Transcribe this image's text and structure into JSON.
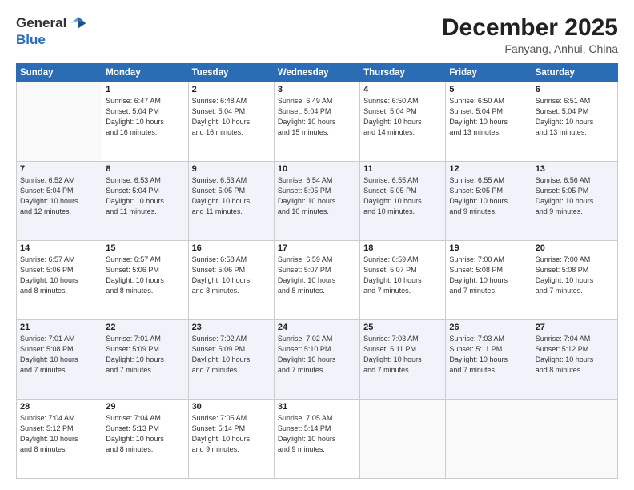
{
  "header": {
    "logo_general": "General",
    "logo_blue": "Blue",
    "month": "December 2025",
    "location": "Fanyang, Anhui, China"
  },
  "days_of_week": [
    "Sunday",
    "Monday",
    "Tuesday",
    "Wednesday",
    "Thursday",
    "Friday",
    "Saturday"
  ],
  "weeks": [
    [
      {
        "day": "",
        "info": ""
      },
      {
        "day": "1",
        "info": "Sunrise: 6:47 AM\nSunset: 5:04 PM\nDaylight: 10 hours\nand 16 minutes."
      },
      {
        "day": "2",
        "info": "Sunrise: 6:48 AM\nSunset: 5:04 PM\nDaylight: 10 hours\nand 16 minutes."
      },
      {
        "day": "3",
        "info": "Sunrise: 6:49 AM\nSunset: 5:04 PM\nDaylight: 10 hours\nand 15 minutes."
      },
      {
        "day": "4",
        "info": "Sunrise: 6:50 AM\nSunset: 5:04 PM\nDaylight: 10 hours\nand 14 minutes."
      },
      {
        "day": "5",
        "info": "Sunrise: 6:50 AM\nSunset: 5:04 PM\nDaylight: 10 hours\nand 13 minutes."
      },
      {
        "day": "6",
        "info": "Sunrise: 6:51 AM\nSunset: 5:04 PM\nDaylight: 10 hours\nand 13 minutes."
      }
    ],
    [
      {
        "day": "7",
        "info": "Sunrise: 6:52 AM\nSunset: 5:04 PM\nDaylight: 10 hours\nand 12 minutes."
      },
      {
        "day": "8",
        "info": "Sunrise: 6:53 AM\nSunset: 5:04 PM\nDaylight: 10 hours\nand 11 minutes."
      },
      {
        "day": "9",
        "info": "Sunrise: 6:53 AM\nSunset: 5:05 PM\nDaylight: 10 hours\nand 11 minutes."
      },
      {
        "day": "10",
        "info": "Sunrise: 6:54 AM\nSunset: 5:05 PM\nDaylight: 10 hours\nand 10 minutes."
      },
      {
        "day": "11",
        "info": "Sunrise: 6:55 AM\nSunset: 5:05 PM\nDaylight: 10 hours\nand 10 minutes."
      },
      {
        "day": "12",
        "info": "Sunrise: 6:55 AM\nSunset: 5:05 PM\nDaylight: 10 hours\nand 9 minutes."
      },
      {
        "day": "13",
        "info": "Sunrise: 6:56 AM\nSunset: 5:05 PM\nDaylight: 10 hours\nand 9 minutes."
      }
    ],
    [
      {
        "day": "14",
        "info": "Sunrise: 6:57 AM\nSunset: 5:06 PM\nDaylight: 10 hours\nand 8 minutes."
      },
      {
        "day": "15",
        "info": "Sunrise: 6:57 AM\nSunset: 5:06 PM\nDaylight: 10 hours\nand 8 minutes."
      },
      {
        "day": "16",
        "info": "Sunrise: 6:58 AM\nSunset: 5:06 PM\nDaylight: 10 hours\nand 8 minutes."
      },
      {
        "day": "17",
        "info": "Sunrise: 6:59 AM\nSunset: 5:07 PM\nDaylight: 10 hours\nand 8 minutes."
      },
      {
        "day": "18",
        "info": "Sunrise: 6:59 AM\nSunset: 5:07 PM\nDaylight: 10 hours\nand 7 minutes."
      },
      {
        "day": "19",
        "info": "Sunrise: 7:00 AM\nSunset: 5:08 PM\nDaylight: 10 hours\nand 7 minutes."
      },
      {
        "day": "20",
        "info": "Sunrise: 7:00 AM\nSunset: 5:08 PM\nDaylight: 10 hours\nand 7 minutes."
      }
    ],
    [
      {
        "day": "21",
        "info": "Sunrise: 7:01 AM\nSunset: 5:08 PM\nDaylight: 10 hours\nand 7 minutes."
      },
      {
        "day": "22",
        "info": "Sunrise: 7:01 AM\nSunset: 5:09 PM\nDaylight: 10 hours\nand 7 minutes."
      },
      {
        "day": "23",
        "info": "Sunrise: 7:02 AM\nSunset: 5:09 PM\nDaylight: 10 hours\nand 7 minutes."
      },
      {
        "day": "24",
        "info": "Sunrise: 7:02 AM\nSunset: 5:10 PM\nDaylight: 10 hours\nand 7 minutes."
      },
      {
        "day": "25",
        "info": "Sunrise: 7:03 AM\nSunset: 5:11 PM\nDaylight: 10 hours\nand 7 minutes."
      },
      {
        "day": "26",
        "info": "Sunrise: 7:03 AM\nSunset: 5:11 PM\nDaylight: 10 hours\nand 7 minutes."
      },
      {
        "day": "27",
        "info": "Sunrise: 7:04 AM\nSunset: 5:12 PM\nDaylight: 10 hours\nand 8 minutes."
      }
    ],
    [
      {
        "day": "28",
        "info": "Sunrise: 7:04 AM\nSunset: 5:12 PM\nDaylight: 10 hours\nand 8 minutes."
      },
      {
        "day": "29",
        "info": "Sunrise: 7:04 AM\nSunset: 5:13 PM\nDaylight: 10 hours\nand 8 minutes."
      },
      {
        "day": "30",
        "info": "Sunrise: 7:05 AM\nSunset: 5:14 PM\nDaylight: 10 hours\nand 9 minutes."
      },
      {
        "day": "31",
        "info": "Sunrise: 7:05 AM\nSunset: 5:14 PM\nDaylight: 10 hours\nand 9 minutes."
      },
      {
        "day": "",
        "info": ""
      },
      {
        "day": "",
        "info": ""
      },
      {
        "day": "",
        "info": ""
      }
    ]
  ]
}
